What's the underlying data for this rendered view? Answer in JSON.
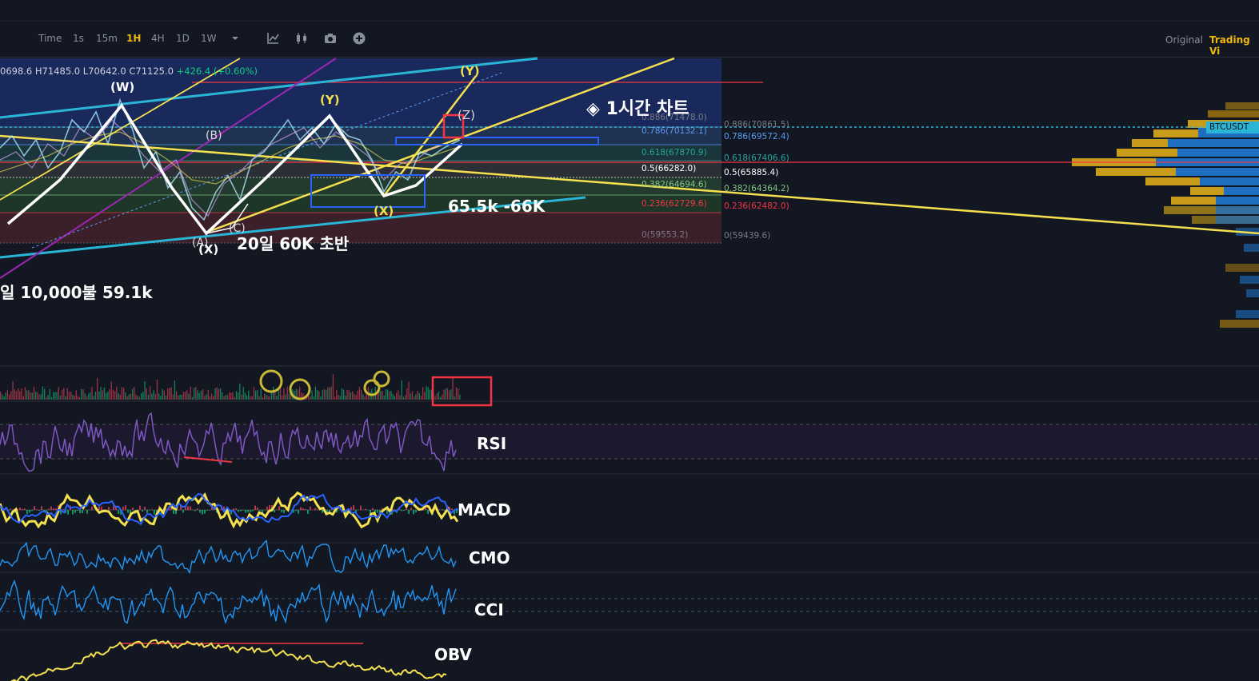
{
  "toolbar": {
    "intervals": [
      {
        "label": "Time",
        "active": false
      },
      {
        "label": "1s",
        "active": false
      },
      {
        "label": "15m",
        "active": false
      },
      {
        "label": "1H",
        "active": true
      },
      {
        "label": "4H",
        "active": false
      },
      {
        "label": "1D",
        "active": false
      },
      {
        "label": "1W",
        "active": false
      }
    ],
    "views": {
      "original": "Original",
      "tradingview": "Trading Vi"
    },
    "icons": [
      "chevron-down-icon",
      "indicator-icon",
      "candle-type-icon",
      "camera-icon",
      "add-icon"
    ]
  },
  "ohlc": {
    "open": "0698.6",
    "high": "H71485.0",
    "low": "L70642.0",
    "close": "C71125.0",
    "change": "+426.4 (+0.60%)"
  },
  "symbol_tag": "BTCUSDT",
  "annotations": {
    "chart_title": "◈ 1시간 차트",
    "zone": "65.5k -66K",
    "note1": "20일 60K 초반",
    "note2": "일 10,000불 59.1k"
  },
  "waves": {
    "W": "(W)",
    "B": "(B)",
    "C": "(C)",
    "A": "(A)",
    "X1": "(X)",
    "X2": "(X)",
    "Y1": "(Y)",
    "Y2": "(Y)",
    "Z": "(Z)"
  },
  "fib_left": [
    {
      "label": "0.886(71478.0)",
      "color": "#787b86"
    },
    {
      "label": "0.786(70132.1)",
      "color": "#5b9cf6"
    },
    {
      "label": "0.618(67870.9)",
      "color": "#26a69a"
    },
    {
      "label": "0.5(66282.0)",
      "color": "#ffffff"
    },
    {
      "label": "0.382(64694.6)",
      "color": "#81c784"
    },
    {
      "label": "0.236(62729.6)",
      "color": "#f23645"
    },
    {
      "label": "0(59553.2)",
      "color": "#787b86"
    }
  ],
  "fib_right": [
    {
      "label": "0.886(70861.5)",
      "color": "#787b86"
    },
    {
      "label": "0.786(69572.4)",
      "color": "#5b9cf6"
    },
    {
      "label": "0.618(67406.6)",
      "color": "#26a69a"
    },
    {
      "label": "0.5(65885.4)",
      "color": "#ffffff"
    },
    {
      "label": "0.382(64364.2)",
      "color": "#81c784"
    },
    {
      "label": "0.236(62482.0)",
      "color": "#f23645"
    },
    {
      "label": "0(59439.6)",
      "color": "#787b86"
    }
  ],
  "indicators": {
    "rsi": "RSI",
    "macd": "MACD",
    "cmo": "CMO",
    "cci": "CCI",
    "obv": "OBV"
  },
  "colors": {
    "bg": "#131722",
    "accent": "#f0b90b",
    "up": "#0ecb81",
    "down": "#f6465d"
  }
}
